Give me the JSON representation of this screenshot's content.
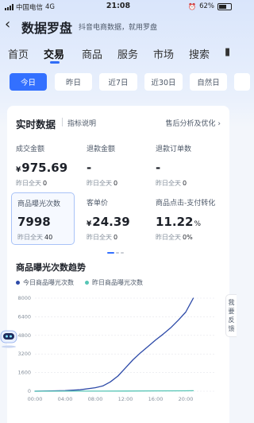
{
  "status_bar": {
    "carrier": "中国电信",
    "network": "4G",
    "time": "21:08",
    "battery": "62%"
  },
  "header": {
    "title": "数据罗盘",
    "subtitle": "抖音电商数据，就用罗盘"
  },
  "tabs": [
    {
      "label": "首页"
    },
    {
      "label": "交易"
    },
    {
      "label": "商品"
    },
    {
      "label": "服务"
    },
    {
      "label": "市场"
    },
    {
      "label": "搜索"
    }
  ],
  "active_tab": "交易",
  "date_ranges": [
    {
      "label": "今日"
    },
    {
      "label": "昨日"
    },
    {
      "label": "近7日"
    },
    {
      "label": "近30日"
    },
    {
      "label": "自然日"
    }
  ],
  "realtime": {
    "title": "实时数据",
    "note": "指标说明",
    "link": "售后分析及优化 ›",
    "metrics": [
      {
        "name": "成交金额",
        "currency": "¥",
        "value": "975.69",
        "unit": "",
        "cmp_label": "昨日全天",
        "cmp_value": "0"
      },
      {
        "name": "退款金额",
        "currency": "",
        "value": "-",
        "unit": "",
        "cmp_label": "昨日全天",
        "cmp_value": "0"
      },
      {
        "name": "退款订单数",
        "currency": "",
        "value": "-",
        "unit": "",
        "cmp_label": "昨日全天",
        "cmp_value": "0"
      },
      {
        "name": "商品曝光次数",
        "currency": "",
        "value": "7998",
        "unit": "",
        "cmp_label": "昨日全天",
        "cmp_value": "40"
      },
      {
        "name": "客单价",
        "currency": "¥",
        "value": "24.39",
        "unit": "",
        "cmp_label": "昨日全天",
        "cmp_value": "0"
      },
      {
        "name": "商品点击-支付转化",
        "currency": "",
        "value": "11.22",
        "unit": "%",
        "cmp_label": "昨日全天",
        "cmp_value": "0%"
      }
    ]
  },
  "trend": {
    "title": "商品曝光次数趋势",
    "legend": [
      {
        "label": "今日商品曝光次数",
        "color": "#2d4aa8"
      },
      {
        "label": "昨日商品曝光次数",
        "color": "#56c5b5"
      }
    ]
  },
  "chart_data": {
    "type": "line",
    "title": "商品曝光次数趋势",
    "xlabel": "",
    "ylabel": "",
    "x_ticks": [
      "00:00",
      "04:00",
      "08:00",
      "12:00",
      "16:00",
      "20:00"
    ],
    "y_ticks": [
      "0",
      "1600",
      "3200",
      "4800",
      "6400",
      "8000"
    ],
    "xlim": [
      0,
      24
    ],
    "ylim": [
      0,
      8000
    ],
    "grid": true,
    "series": [
      {
        "name": "今日商品曝光次数",
        "x": [
          0,
          2,
          4,
          6,
          8,
          9,
          10,
          11,
          12,
          13,
          14,
          15,
          16,
          17,
          18,
          19,
          20,
          21
        ],
        "values": [
          0,
          20,
          50,
          120,
          300,
          450,
          800,
          1300,
          2000,
          2700,
          3300,
          3850,
          4400,
          4900,
          5450,
          6100,
          6800,
          7998
        ]
      },
      {
        "name": "昨日商品曝光次数",
        "x": [
          0,
          4,
          8,
          12,
          16,
          20,
          21
        ],
        "values": [
          0,
          5,
          10,
          15,
          25,
          35,
          40
        ]
      }
    ]
  },
  "side_buttons": {
    "feedback": "我要反馈"
  }
}
